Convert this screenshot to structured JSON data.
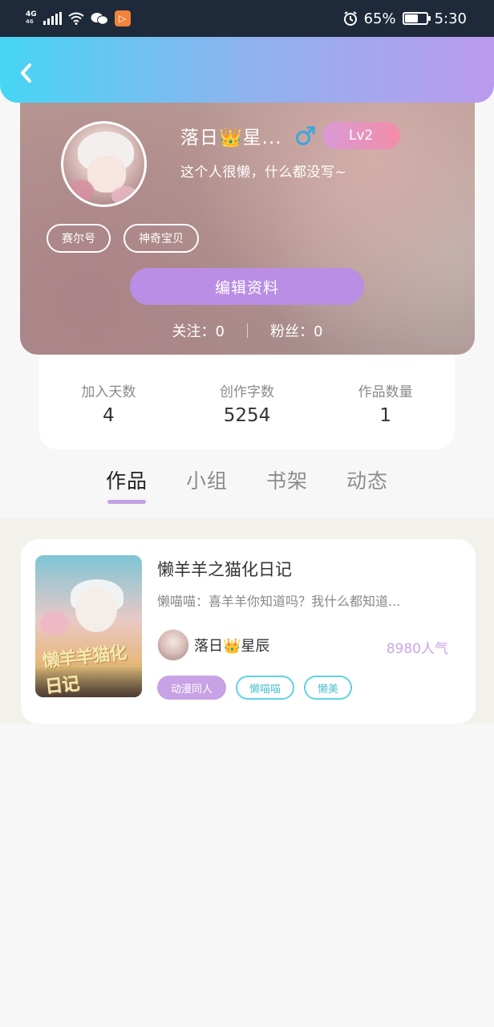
{
  "status_bar": {
    "network": "4G",
    "network_sub": "46",
    "battery": "65%",
    "battery_level": 0.65,
    "time": "5:30",
    "icons": [
      "signal-icon",
      "wifi-icon",
      "wechat-icon",
      "app-notification-icon",
      "alarm-icon",
      "battery-icon"
    ]
  },
  "header": {
    "back_icon": "chevron-left-icon"
  },
  "profile": {
    "name": "落日👑星...",
    "gender_icon": "male-symbol-icon",
    "level": "Lv2",
    "bio": "这个人很懒，什么都没写~",
    "tags": [
      "赛尔号",
      "神奇宝贝"
    ],
    "edit_label": "编辑资料",
    "following_label": "关注：0",
    "followers_label": "粉丝：0"
  },
  "stats": [
    {
      "label": "加入天数",
      "value": "4"
    },
    {
      "label": "创作字数",
      "value": "5254"
    },
    {
      "label": "作品数量",
      "value": "1"
    }
  ],
  "tabs": [
    {
      "label": "作品",
      "active": true
    },
    {
      "label": "小组",
      "active": false
    },
    {
      "label": "书架",
      "active": false
    },
    {
      "label": "动态",
      "active": false
    }
  ],
  "works": [
    {
      "title": "懒羊羊之猫化日记",
      "description": "懒喵喵：喜羊羊你知道吗？我什么都知道...",
      "cover_text": "懒羊羊猫化日记",
      "author": "落日👑星辰",
      "popularity": "8980人气",
      "tags": [
        "动漫同人",
        "懒喵喵",
        "懒美"
      ]
    }
  ],
  "colors": {
    "accent_purple": "#b98ee4",
    "tag_cyan": "#5fd3e2",
    "popularity": "#c9a6e6"
  }
}
